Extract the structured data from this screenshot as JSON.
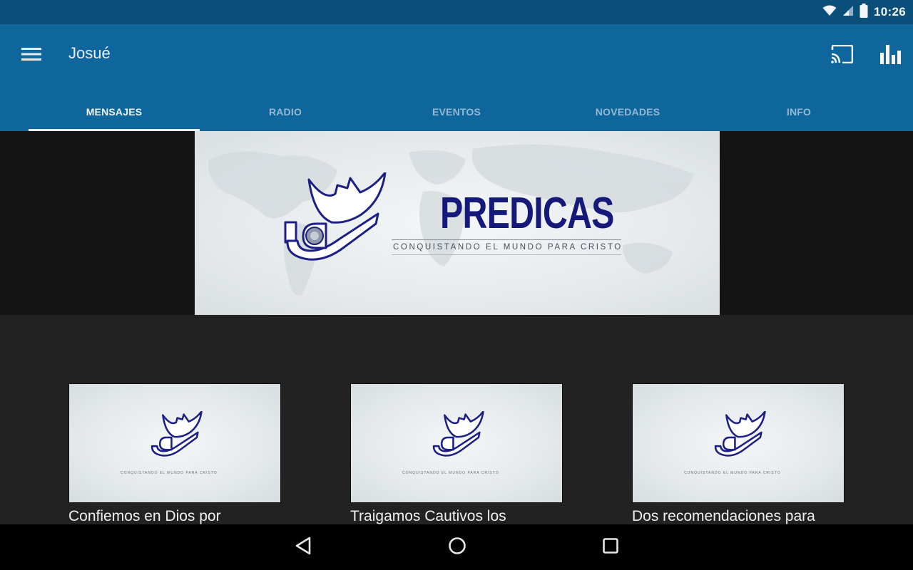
{
  "status_bar": {
    "time": "10:26",
    "icons": [
      "wifi-icon",
      "signal-icon",
      "battery-icon"
    ]
  },
  "app_bar": {
    "title": "Josué",
    "menu_icon": "hamburger-menu-icon",
    "actions": [
      {
        "name": "cast",
        "icon": "cast-icon"
      },
      {
        "name": "stats",
        "icon": "bar-chart-icon"
      }
    ],
    "colors": {
      "status_bar": "#0a4f7a",
      "app_bar": "#0e669d",
      "tab_inactive": "#93b9d3",
      "tab_active": "#eef4f8"
    }
  },
  "tabs": [
    {
      "label": "MENSAJES",
      "active": true
    },
    {
      "label": "RADIO",
      "active": false
    },
    {
      "label": "EVENTOS",
      "active": false
    },
    {
      "label": "NOVEDADES",
      "active": false
    },
    {
      "label": "INFO",
      "active": false
    }
  ],
  "hero": {
    "title": "PREDICAS",
    "tagline": "CONQUISTANDO EL MUNDO PARA CRISTO",
    "brand_color": "#14197a"
  },
  "cards": [
    {
      "title": "Confiemos en Dios por",
      "thumb_tagline": "CONQUISTANDO EL MUNDO PARA CRISTO"
    },
    {
      "title": "Traigamos Cautivos los",
      "thumb_tagline": "CONQUISTANDO EL MUNDO PARA CRISTO"
    },
    {
      "title": "Dos recomendaciones para",
      "thumb_tagline": "CONQUISTANDO EL MUNDO PARA CRISTO"
    }
  ],
  "nav_bar": {
    "buttons": [
      {
        "name": "back",
        "icon": "back-triangle-icon"
      },
      {
        "name": "home",
        "icon": "home-circle-icon"
      },
      {
        "name": "recents",
        "icon": "recents-square-icon"
      }
    ]
  }
}
